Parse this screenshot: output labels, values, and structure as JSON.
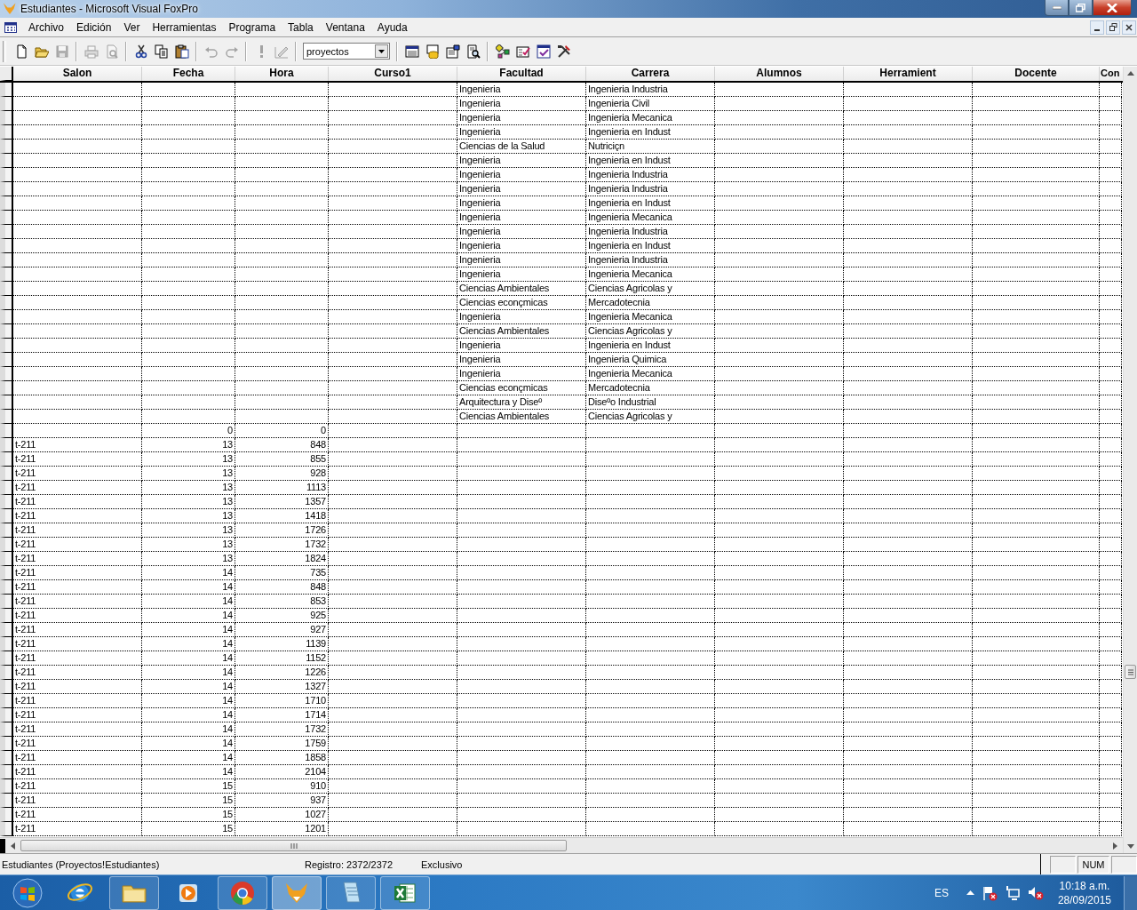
{
  "window": {
    "title": "Estudiantes - Microsoft Visual FoxPro"
  },
  "menu": [
    "Archivo",
    "Edición",
    "Ver",
    "Herramientas",
    "Programa",
    "Tabla",
    "Ventana",
    "Ayuda"
  ],
  "toolbar": {
    "buttons": [
      {
        "disabled": false
      },
      {
        "disabled": false
      },
      {
        "disabled": true
      },
      {
        "disabled": true
      },
      {
        "disabled": true
      },
      {
        "disabled": false
      },
      {
        "disabled": false
      },
      {
        "disabled": false
      },
      {
        "disabled": true
      },
      {
        "disabled": true
      },
      {
        "disabled": true
      },
      {
        "disabled": true
      },
      {
        "disabled": false
      },
      {
        "disabled": false
      },
      {
        "disabled": false
      },
      {
        "disabled": false
      },
      {
        "disabled": false
      },
      {
        "disabled": false
      },
      {
        "disabled": false
      },
      {
        "disabled": false
      }
    ],
    "combo": {
      "value": "proyectos"
    }
  },
  "table": {
    "columns": [
      "Salon",
      "Fecha",
      "Hora",
      "Curso1",
      "Facultad",
      "Carrera",
      "Alumnos",
      "Herramient",
      "Docente",
      "Con"
    ],
    "rows": [
      {
        "facultad": "Ingenieria",
        "carrera": "Ingenieria Industria"
      },
      {
        "facultad": "Ingenieria",
        "carrera": "Ingenieria Civil"
      },
      {
        "facultad": "Ingenieria",
        "carrera": "Ingenieria Mecanica"
      },
      {
        "facultad": "Ingenieria",
        "carrera": "Ingenieria en Indust"
      },
      {
        "facultad": "Ciencias de la Salud",
        "carrera": "Nutriciçn"
      },
      {
        "facultad": "Ingenieria",
        "carrera": "Ingenieria en Indust"
      },
      {
        "facultad": "Ingenieria",
        "carrera": "Ingenieria Industria"
      },
      {
        "facultad": "Ingenieria",
        "carrera": "Ingenieria Industria"
      },
      {
        "facultad": "Ingenieria",
        "carrera": "Ingenieria en Indust"
      },
      {
        "facultad": "Ingenieria",
        "carrera": "Ingenieria Mecanica"
      },
      {
        "facultad": "Ingenieria",
        "carrera": "Ingenieria Industria"
      },
      {
        "facultad": "Ingenieria",
        "carrera": "Ingenieria en Indust"
      },
      {
        "facultad": "Ingenieria",
        "carrera": "Ingenieria Industria"
      },
      {
        "facultad": "Ingenieria",
        "carrera": "Ingenieria Mecanica"
      },
      {
        "facultad": "Ciencias Ambientales",
        "carrera": "Ciencias Agricolas y"
      },
      {
        "facultad": "Ciencias econçmicas",
        "carrera": "Mercadotecnia"
      },
      {
        "facultad": "Ingenieria",
        "carrera": "Ingenieria Mecanica"
      },
      {
        "facultad": "Ciencias Ambientales",
        "carrera": "Ciencias Agricolas y"
      },
      {
        "facultad": "Ingenieria",
        "carrera": "Ingenieria en Indust"
      },
      {
        "facultad": "Ingenieria",
        "carrera": "Ingenieria Quimica"
      },
      {
        "facultad": "Ingenieria",
        "carrera": "Ingenieria Mecanica"
      },
      {
        "facultad": "Ciencias econçmicas",
        "carrera": "Mercadotecnia"
      },
      {
        "facultad": "Arquitectura y Diseº",
        "carrera": "Diseºo Industrial"
      },
      {
        "facultad": "Ciencias Ambientales",
        "carrera": "Ciencias Agricolas y"
      },
      {
        "fecha": "0",
        "hora": "0"
      },
      {
        "salon": "t-211",
        "fecha": "13",
        "hora": "848"
      },
      {
        "salon": "t-211",
        "fecha": "13",
        "hora": "855"
      },
      {
        "salon": "t-211",
        "fecha": "13",
        "hora": "928"
      },
      {
        "salon": "t-211",
        "fecha": "13",
        "hora": "1113"
      },
      {
        "salon": "t-211",
        "fecha": "13",
        "hora": "1357"
      },
      {
        "salon": "t-211",
        "fecha": "13",
        "hora": "1418"
      },
      {
        "salon": "t-211",
        "fecha": "13",
        "hora": "1726"
      },
      {
        "salon": "t-211",
        "fecha": "13",
        "hora": "1732"
      },
      {
        "salon": "t-211",
        "fecha": "13",
        "hora": "1824"
      },
      {
        "salon": "t-211",
        "fecha": "14",
        "hora": "735"
      },
      {
        "salon": "t-211",
        "fecha": "14",
        "hora": "848"
      },
      {
        "salon": "t-211",
        "fecha": "14",
        "hora": "853"
      },
      {
        "salon": "t-211",
        "fecha": "14",
        "hora": "925"
      },
      {
        "salon": "t-211",
        "fecha": "14",
        "hora": "927"
      },
      {
        "salon": "t-211",
        "fecha": "14",
        "hora": "1139"
      },
      {
        "salon": "t-211",
        "fecha": "14",
        "hora": "1152"
      },
      {
        "salon": "t-211",
        "fecha": "14",
        "hora": "1226"
      },
      {
        "salon": "t-211",
        "fecha": "14",
        "hora": "1327"
      },
      {
        "salon": "t-211",
        "fecha": "14",
        "hora": "1710"
      },
      {
        "salon": "t-211",
        "fecha": "14",
        "hora": "1714"
      },
      {
        "salon": "t-211",
        "fecha": "14",
        "hora": "1732"
      },
      {
        "salon": "t-211",
        "fecha": "14",
        "hora": "1759"
      },
      {
        "salon": "t-211",
        "fecha": "14",
        "hora": "1858"
      },
      {
        "salon": "t-211",
        "fecha": "14",
        "hora": "2104"
      },
      {
        "salon": "t-211",
        "fecha": "15",
        "hora": "910"
      },
      {
        "salon": "t-211",
        "fecha": "15",
        "hora": "937"
      },
      {
        "salon": "t-211",
        "fecha": "15",
        "hora": "1027"
      },
      {
        "salon": "t-211",
        "fecha": "15",
        "hora": "1201"
      }
    ]
  },
  "status_bar": {
    "table": "Estudiantes (Proyectos!Estudiantes)",
    "record": "Registro: 2372/2372",
    "mode": "Exclusivo",
    "indicator": "NUM"
  },
  "taskbar": {
    "apps": [
      {
        "running": false,
        "selected": false
      },
      {
        "running": true,
        "selected": false
      },
      {
        "running": false,
        "selected": false
      },
      {
        "running": true,
        "selected": false
      },
      {
        "running": true,
        "selected": true
      },
      {
        "running": true,
        "selected": false
      },
      {
        "running": true,
        "selected": false
      }
    ],
    "language": "ES",
    "time": "10:18 a.m.",
    "date": "28/09/2015"
  }
}
